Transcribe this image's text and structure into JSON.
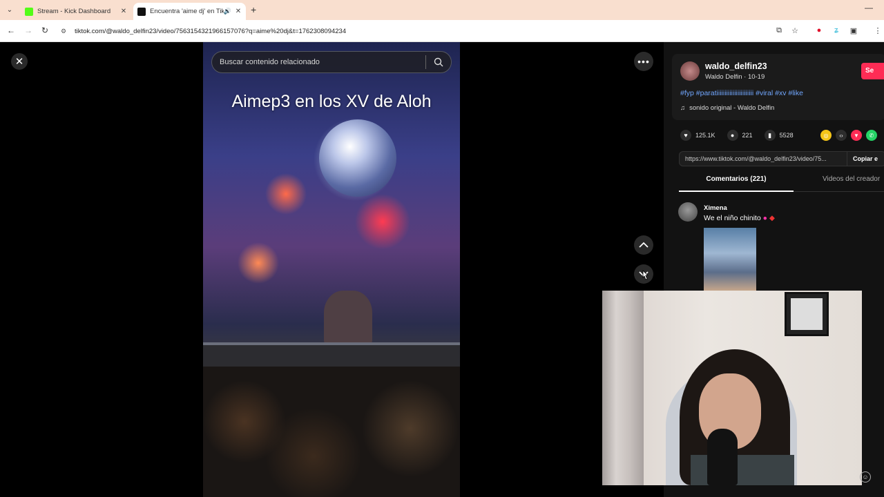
{
  "browser": {
    "tabs": [
      {
        "title": "Stream - Kick Dashboard",
        "favicon_color": "#53fc18"
      },
      {
        "title": "Encuentra 'aime dj' en TikTok",
        "favicon_color": "#111111"
      }
    ],
    "url": "tiktok.com/@waldo_delfin23/video/7563154321966157076?q=aime%20dj&t=1762308094234"
  },
  "search": {
    "placeholder": "Buscar contenido relacionado"
  },
  "video": {
    "caption": "Aimep3 en los XV de Aloh"
  },
  "author": {
    "username": "waldo_delfin23",
    "subtitle": "Waldo Delfin · 10-19",
    "follow_label": "Se",
    "description": "#fyp #paratiiiiiiiiiiiiiiiiiiiiiii #viral #xv #like",
    "music": "sonido original - Waldo Delfin"
  },
  "stats": {
    "likes": "125.1K",
    "comments": "221",
    "saves": "5528"
  },
  "share": {
    "link": "https://www.tiktok.com/@waldo_delfin23/video/75...",
    "copy_label": "Copiar e"
  },
  "panel_tabs": {
    "comments": "Comentarios (221)",
    "creator_videos": "Videos del creador"
  },
  "comment": {
    "user": "Ximena",
    "text": "We el niño chinito"
  },
  "colors": {
    "accent": "#fe2c55",
    "hashtag": "#71a7ff"
  }
}
